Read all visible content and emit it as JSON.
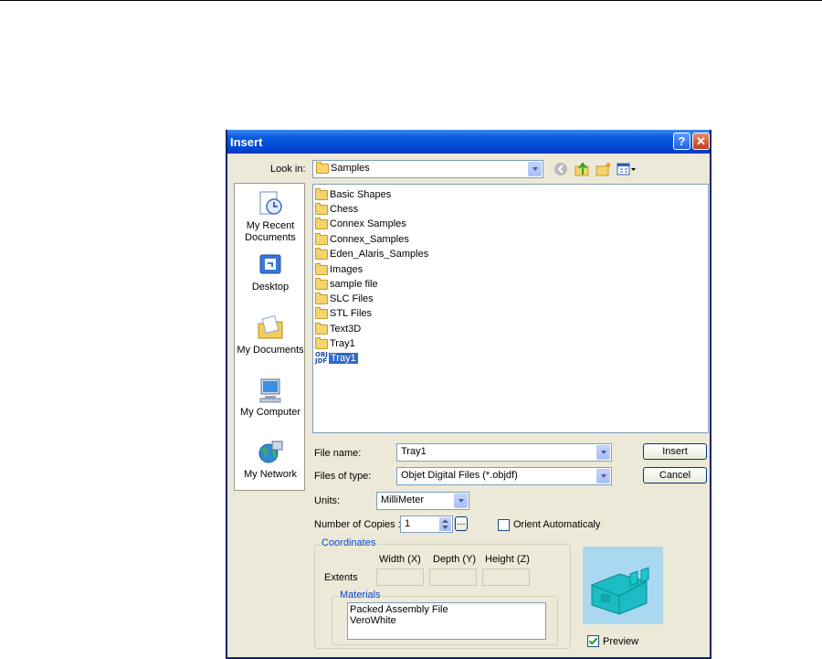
{
  "dialog": {
    "title": "Insert",
    "help_glyph": "?",
    "close_glyph": "✕"
  },
  "lookin": {
    "label": "Look in:",
    "value": "Samples"
  },
  "places": [
    {
      "label": "My Recent\nDocuments",
      "icon": "recent-documents-icon"
    },
    {
      "label": "Desktop",
      "icon": "desktop-icon"
    },
    {
      "label": "My Documents",
      "icon": "my-documents-icon"
    },
    {
      "label": "My Computer",
      "icon": "my-computer-icon"
    },
    {
      "label": "My Network",
      "icon": "my-network-icon"
    }
  ],
  "files": [
    {
      "name": "Basic Shapes",
      "type": "folder"
    },
    {
      "name": "Chess",
      "type": "folder"
    },
    {
      "name": "Connex Samples",
      "type": "folder"
    },
    {
      "name": "Connex_Samples",
      "type": "folder"
    },
    {
      "name": "Eden_Alaris_Samples",
      "type": "folder"
    },
    {
      "name": "Images",
      "type": "folder"
    },
    {
      "name": "sample file",
      "type": "folder"
    },
    {
      "name": "SLC Files",
      "type": "folder"
    },
    {
      "name": "STL Files",
      "type": "folder"
    },
    {
      "name": "Text3D",
      "type": "folder"
    },
    {
      "name": "Tray1",
      "type": "folder"
    },
    {
      "name": "Tray1",
      "type": "objdf",
      "icon_text": "OBJ\nJDF",
      "selected": true
    }
  ],
  "filename": {
    "label": "File name:",
    "value": "Tray1"
  },
  "filetype": {
    "label": "Files of type:",
    "value": "Objet Digital Files (*.objdf)"
  },
  "buttons": {
    "insert": "Insert",
    "cancel": "Cancel",
    "ellipsis": "..."
  },
  "units": {
    "label": "Units:",
    "value": "MilliMeter"
  },
  "copies": {
    "label": "Number of Copies :",
    "value": "1"
  },
  "orient": {
    "label": "Orient Automaticaly",
    "checked": false
  },
  "coordinates": {
    "legend": "Coordinates",
    "extents_label": "Extents",
    "headers": [
      "Width (X)",
      "Depth (Y)",
      "Height (Z)"
    ]
  },
  "materials": {
    "legend": "Materials",
    "items": [
      "Packed Assembly File",
      "VeroWhite"
    ]
  },
  "preview": {
    "label": "Preview",
    "checked": true
  },
  "colors": {
    "title_blue": "#0046d5",
    "selection": "#316ac5",
    "dialog_bg": "#ece9d8",
    "preview_bg": "#a9d8f0"
  }
}
